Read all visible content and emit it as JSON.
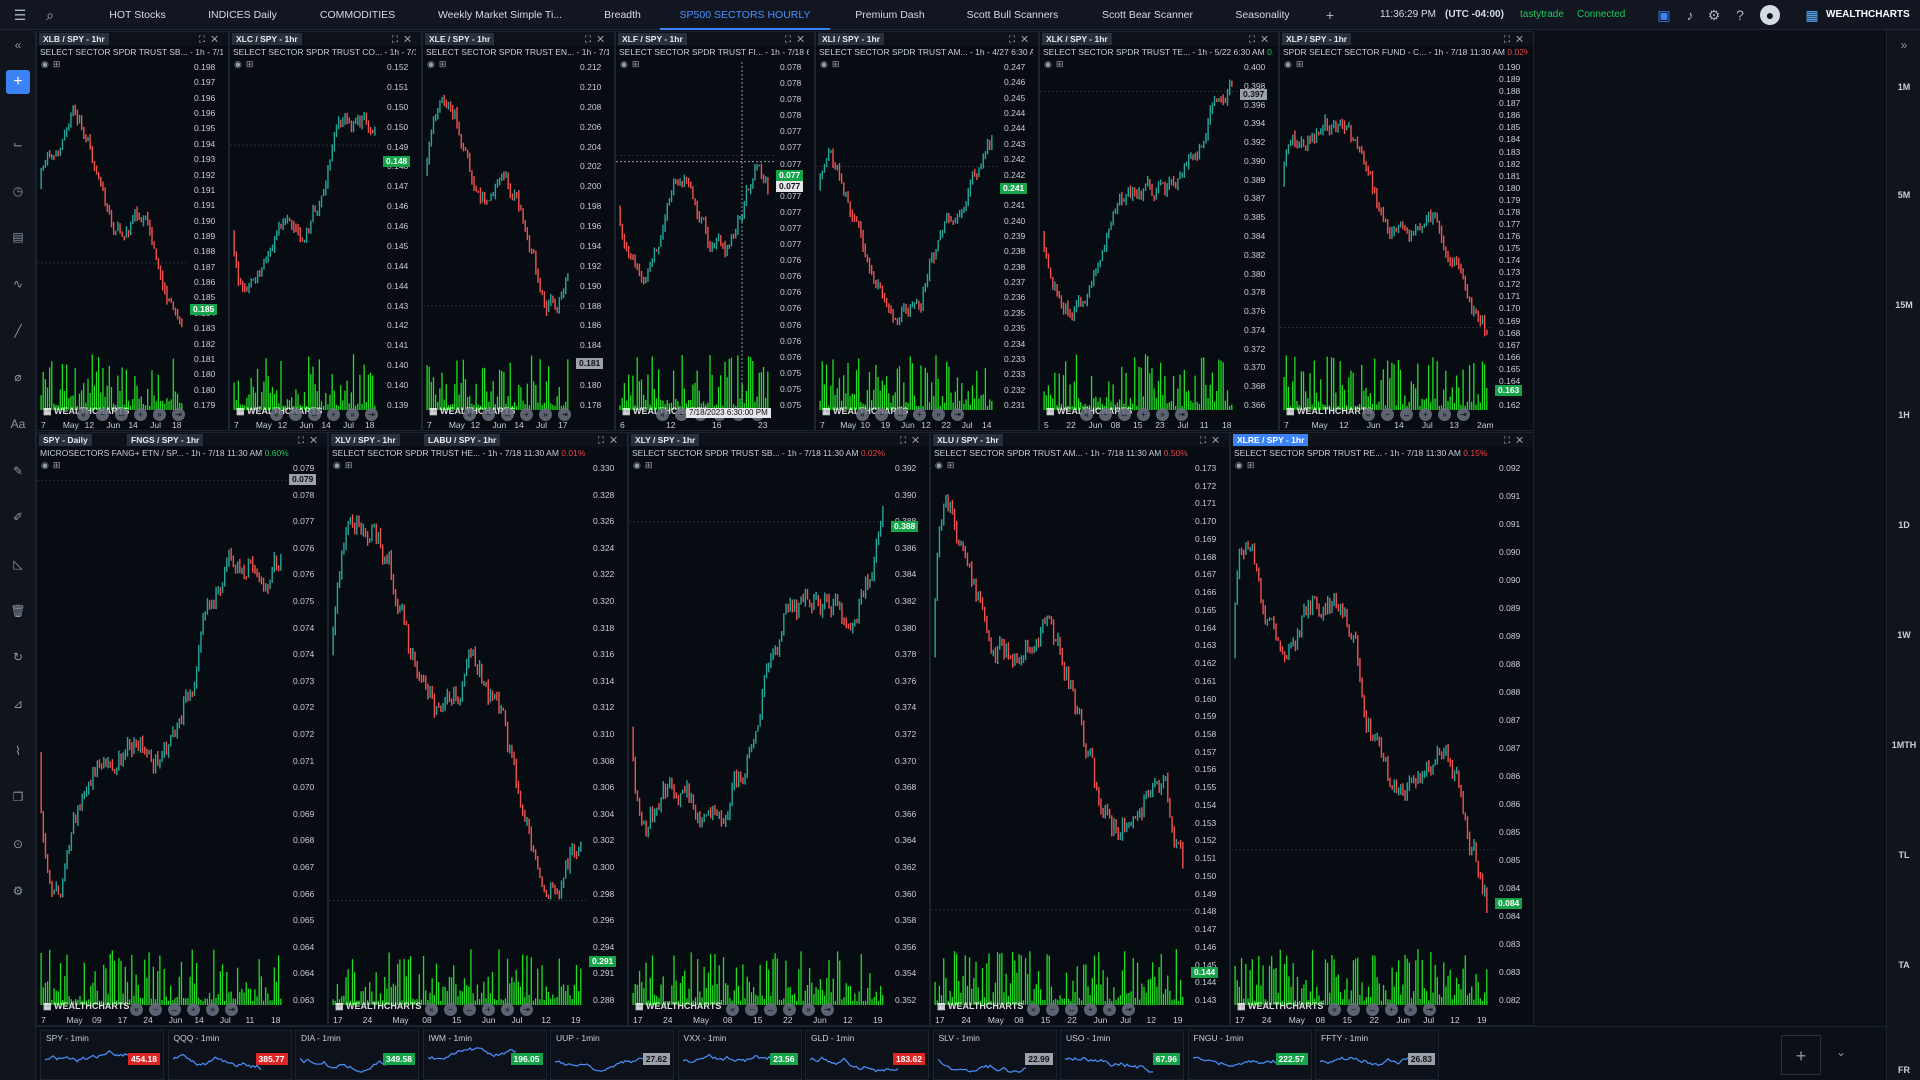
{
  "topbar": {
    "tabs": [
      "HOT Stocks",
      "INDICES Daily",
      "COMMODITIES",
      "Weekly Market Simple Ti...",
      "Breadth",
      "SP500 SECTORS HOURLY",
      "Premium Dash",
      "Scott Bull Scanners",
      "Scott Bear Scanner",
      "Seasonality"
    ],
    "active_tab": 5,
    "time": "11:36:29 PM",
    "timezone": "(UTC -04:00)",
    "broker": "tastytrade",
    "status": "Connected",
    "brand": "WEALTHCHARTS",
    "colors": {
      "accent": "#3b82f6",
      "up": "#22c55e",
      "down": "#ef4444"
    }
  },
  "rightbar": {
    "timeframes": [
      "1M",
      "5M",
      "15M",
      "1H",
      "1D",
      "1W",
      "1MTH",
      "TL",
      "TA",
      "FR"
    ]
  },
  "panels": [
    {
      "id": "xlb",
      "sym": "XLB / SPY - 1hr",
      "desc": "SELECT SECTOR SPDR TRUST SB... - 1h - 7/18 11:30 A",
      "chg": "",
      "ticks": [
        "0.198",
        "0.197",
        "0.196",
        "0.196",
        "0.195",
        "0.194",
        "0.193",
        "0.192",
        "0.191",
        "0.191",
        "0.190",
        "0.189",
        "0.188",
        "0.187",
        "0.186",
        "0.185",
        "0.184",
        "0.183",
        "0.182",
        "0.181",
        "0.180",
        "0.180",
        "0.179"
      ],
      "price": "0.185",
      "price_frac": 0.72,
      "x": [
        "7",
        "May",
        "12",
        "Jun",
        "14",
        "Jul",
        "18"
      ],
      "series_seed": 1,
      "trend": "down"
    },
    {
      "id": "xlc",
      "sym": "XLC / SPY - 1hr",
      "desc": "SELECT SECTOR SPDR TRUST CO... - 1h - 7/19 2:30 AM",
      "chg": "",
      "ticks": [
        "0.152",
        "0.151",
        "0.150",
        "0.150",
        "0.149",
        "0.148",
        "0.147",
        "0.146",
        "0.146",
        "0.145",
        "0.144",
        "0.144",
        "0.143",
        "0.142",
        "0.141",
        "0.140",
        "0.140",
        "0.139"
      ],
      "price": "0.148",
      "price_frac": 0.28,
      "x": [
        "7",
        "May",
        "12",
        "Jun",
        "14",
        "Jul",
        "18"
      ],
      "series_seed": 2,
      "trend": "up"
    },
    {
      "id": "xle",
      "sym": "XLE / SPY - 1hr",
      "desc": "SELECT SECTOR SPDR TRUST EN... - 1h - 7/19 2:30 AM",
      "chg": "",
      "ticks": [
        "0.212",
        "0.210",
        "0.208",
        "0.206",
        "0.204",
        "0.202",
        "0.200",
        "0.198",
        "0.196",
        "0.194",
        "0.192",
        "0.190",
        "0.188",
        "0.186",
        "0.184",
        "0.182",
        "0.180",
        "0.178"
      ],
      "price": "0.181",
      "price_frac": 0.88,
      "price_style": "grey",
      "x": [
        "7",
        "May",
        "12",
        "Jun",
        "14",
        "Jul",
        "17"
      ],
      "series_seed": 3,
      "trend": "down"
    },
    {
      "id": "xlf",
      "sym": "XLF / SPY - 1hr",
      "desc": "SELECT SECTOR SPDR TRUST FI... - 1h - 7/18 6:30 PM",
      "chg": "",
      "ticks": [
        "0.078",
        "0.078",
        "0.078",
        "0.078",
        "0.077",
        "0.077",
        "0.077",
        "0.077",
        "0.077",
        "0.077",
        "0.077",
        "0.077",
        "0.076",
        "0.076",
        "0.076",
        "0.076",
        "0.076",
        "0.076",
        "0.076",
        "0.075",
        "0.075",
        "0.075"
      ],
      "price": "0.077",
      "price_frac": 0.32,
      "price2": "0.077",
      "x": [
        "6",
        "12",
        "16",
        "23"
      ],
      "crosshair_date": "7/18/2023 6:30:00 PM",
      "series_seed": 4,
      "trend": "updown"
    },
    {
      "id": "xli",
      "sym": "XLI / SPY - 1hr",
      "desc": "SELECT SECTOR SPDR TRUST AM... - 1h - 4/27 6:30 AM",
      "chg": "0.06%",
      "ticks": [
        "0.247",
        "0.246",
        "0.245",
        "0.244",
        "0.244",
        "0.243",
        "0.242",
        "0.242",
        "0.241",
        "0.241",
        "0.240",
        "0.239",
        "0.238",
        "0.238",
        "0.237",
        "0.236",
        "0.235",
        "0.235",
        "0.234",
        "0.233",
        "0.233",
        "0.232",
        "0.231"
      ],
      "price": "0.241",
      "price_frac": 0.36,
      "x": [
        "7",
        "May",
        "10",
        "19",
        "Jun",
        "12",
        "22",
        "Jul",
        "14"
      ],
      "series_seed": 5,
      "trend": "v"
    },
    {
      "id": "xlk",
      "sym": "XLK / SPY - 1hr",
      "desc": "SELECT SECTOR SPDR TRUST TE... - 1h - 5/22 6:30 AM",
      "chg": "0.08%",
      "chg_up": true,
      "ticks": [
        "0.400",
        "0.398",
        "0.396",
        "0.394",
        "0.392",
        "0.390",
        "0.389",
        "0.387",
        "0.385",
        "0.384",
        "0.382",
        "0.380",
        "0.378",
        "0.376",
        "0.374",
        "0.372",
        "0.370",
        "0.368",
        "0.366"
      ],
      "price": "0.397",
      "price_frac": 0.08,
      "price_style": "grey",
      "x": [
        "5",
        "22",
        "Jun",
        "08",
        "15",
        "23",
        "Jul",
        "11",
        "18"
      ],
      "series_seed": 6,
      "trend": "up"
    },
    {
      "id": "xlp",
      "sym": "XLP / SPY - 1hr",
      "desc": "SPDR SELECT SECTOR FUND - C... - 1h - 7/18 11:30 AM",
      "chg": "0.02%",
      "ticks": [
        "0.190",
        "0.189",
        "0.188",
        "0.187",
        "0.186",
        "0.185",
        "0.184",
        "0.183",
        "0.182",
        "0.181",
        "0.180",
        "0.179",
        "0.178",
        "0.177",
        "0.176",
        "0.175",
        "0.174",
        "0.173",
        "0.172",
        "0.171",
        "0.170",
        "0.169",
        "0.168",
        "0.167",
        "0.166",
        "0.165",
        "0.164",
        "0.163",
        "0.162"
      ],
      "price": "0.163",
      "price_frac": 0.96,
      "x": [
        "7",
        "May",
        "12",
        "Jun",
        "14",
        "Jul",
        "13",
        "2am"
      ],
      "series_seed": 7,
      "trend": "down"
    },
    {
      "id": "fngs",
      "sym": "SPY - Daily",
      "sym2": "FNGS / SPY - 1hr",
      "desc": "MICROSECTORS FANG+ ETN / SP... - 1h - 7/18 11:30 AM",
      "chg": "0.60%",
      "chg_up": true,
      "ticks": [
        "0.079",
        "0.078",
        "0.077",
        "0.076",
        "0.076",
        "0.075",
        "0.074",
        "0.074",
        "0.073",
        "0.072",
        "0.072",
        "0.071",
        "0.070",
        "0.069",
        "0.068",
        "0.067",
        "0.066",
        "0.065",
        "0.064",
        "0.064",
        "0.063"
      ],
      "price": "0.079",
      "price_frac": 0.02,
      "price_style": "grey",
      "x": [
        "7",
        "May",
        "09",
        "17",
        "24",
        "Jun",
        "14",
        "Jul",
        "11",
        "18"
      ],
      "series_seed": 8,
      "trend": "up"
    },
    {
      "id": "xlv",
      "sym": "XLV / SPY - 1hr",
      "sym2": "LABU / SPY - 1hr",
      "desc": "SELECT SECTOR SPDR TRUST HE... - 1h - 7/18 11:30 AM",
      "chg": "0.01%",
      "ticks": [
        "0.330",
        "0.328",
        "0.326",
        "0.324",
        "0.322",
        "0.320",
        "0.318",
        "0.316",
        "0.314",
        "0.312",
        "0.310",
        "0.308",
        "0.306",
        "0.304",
        "0.302",
        "0.300",
        "0.298",
        "0.296",
        "0.294",
        "0.291",
        "0.288"
      ],
      "price": "0.291",
      "price_frac": 0.93,
      "x": [
        "17",
        "24",
        "May",
        "08",
        "15",
        "Jun",
        "Jul",
        "12",
        "19"
      ],
      "series_seed": 9,
      "trend": "down"
    },
    {
      "id": "xly",
      "sym": "XLY / SPY - 1hr",
      "desc": "SELECT SECTOR SPDR TRUST SB... - 1h - 7/18 11:30 AM",
      "chg": "0.02%",
      "ticks": [
        "0.392",
        "0.390",
        "0.388",
        "0.386",
        "0.384",
        "0.382",
        "0.380",
        "0.378",
        "0.376",
        "0.374",
        "0.372",
        "0.370",
        "0.368",
        "0.366",
        "0.364",
        "0.362",
        "0.360",
        "0.358",
        "0.356",
        "0.354",
        "0.352"
      ],
      "price": "0.388",
      "price_frac": 0.11,
      "x": [
        "17",
        "24",
        "May",
        "08",
        "15",
        "22",
        "Jun",
        "12",
        "19"
      ],
      "series_seed": 10,
      "trend": "up"
    },
    {
      "id": "xlu",
      "sym": "XLU / SPY - 1hr",
      "desc": "SELECT SECTOR SPDR TRUST AM... - 1h - 7/18 11:30 AM",
      "chg": "0.50%",
      "ticks": [
        "0.173",
        "0.172",
        "0.171",
        "0.170",
        "0.169",
        "0.168",
        "0.167",
        "0.166",
        "0.165",
        "0.164",
        "0.163",
        "0.162",
        "0.161",
        "0.160",
        "0.159",
        "0.158",
        "0.157",
        "0.156",
        "0.155",
        "0.154",
        "0.153",
        "0.152",
        "0.151",
        "0.150",
        "0.149",
        "0.148",
        "0.147",
        "0.146",
        "0.145",
        "0.144",
        "0.143"
      ],
      "price": "0.144",
      "price_frac": 0.95,
      "x": [
        "17",
        "24",
        "May",
        "08",
        "15",
        "22",
        "Jun",
        "Jul",
        "12",
        "19"
      ],
      "series_seed": 11,
      "trend": "down"
    },
    {
      "id": "xlre",
      "sym": "XLRE / SPY - 1hr",
      "desc": "SELECT SECTOR SPDR TRUST RE... - 1h - 7/18 11:30 AM",
      "chg": "0.15%",
      "active": true,
      "ticks": [
        "0.092",
        "0.091",
        "0.091",
        "0.090",
        "0.090",
        "0.089",
        "0.089",
        "0.088",
        "0.088",
        "0.087",
        "0.087",
        "0.086",
        "0.086",
        "0.085",
        "0.085",
        "0.084",
        "0.084",
        "0.083",
        "0.083",
        "0.082"
      ],
      "price": "0.084",
      "price_frac": 0.82,
      "x": [
        "17",
        "24",
        "May",
        "08",
        "15",
        "22",
        "Jun",
        "Jul",
        "12",
        "19"
      ],
      "series_seed": 12,
      "trend": "down"
    }
  ],
  "tickers": [
    {
      "name": "SPY - 1min",
      "price": "454.18",
      "up": false
    },
    {
      "name": "QQQ - 1min",
      "price": "385.77",
      "up": false
    },
    {
      "name": "DIA - 1min",
      "price": "349.58",
      "up": true
    },
    {
      "name": "IWM - 1min",
      "price": "196.05",
      "up": true
    },
    {
      "name": "UUP - 1min",
      "price": "27.62",
      "grey": true
    },
    {
      "name": "VXX - 1min",
      "price": "23.56",
      "up": true
    },
    {
      "name": "GLD - 1min",
      "price": "183.62",
      "up": false
    },
    {
      "name": "SLV - 1min",
      "price": "22.99",
      "grey": true
    },
    {
      "name": "USO - 1min",
      "price": "67.96",
      "up": true
    },
    {
      "name": "FNGU - 1min",
      "price": "222.57",
      "up": true
    },
    {
      "name": "FFTY - 1min",
      "price": "26.83",
      "grey": true
    }
  ]
}
